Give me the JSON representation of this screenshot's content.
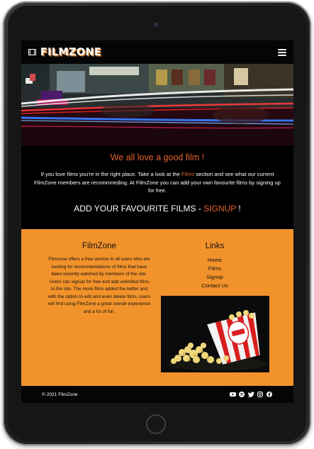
{
  "navbar": {
    "logo_text": "FILMZONE",
    "logo_icon": "film-icon",
    "menu_icon": "hamburger-menu-icon"
  },
  "hero": {
    "image": "night street with car light trails"
  },
  "intro": {
    "heading": "We all love a good film !",
    "text_before": "If you love films you're in the right place. Take a look at the ",
    "films_link": "Films",
    "text_after": " section and see what our current FilmZone members are recommneding. At FilmZone you can add your own favourite films by signing up for free.",
    "cta_before": "ADD YOUR FAVOURITE FILMS - ",
    "cta_signup": "SIGNUP",
    "cta_after": " !"
  },
  "footer": {
    "about_title": "FilmZone",
    "about_text": "Filmzone offers a free service to all users who are looking for recommendations of films that have been recently watched by members of the site. Users can signup for free and add unlimited films to the site. The more films added the better and with the option to edit and even delete films, users will find using FilmZone a great overall experience and a lot of fun.",
    "links_title": "Links",
    "links": [
      "Home",
      "Films",
      "Signup",
      "Contact Us"
    ],
    "image": "popcorn box"
  },
  "bottom": {
    "copyright": "© 2021 FilmZone",
    "social_icons": [
      "youtube-icon",
      "spotify-icon",
      "twitter-icon",
      "instagram-icon",
      "facebook-icon"
    ]
  },
  "colors": {
    "accent": "#e5622d",
    "footer_bg": "#f2922b",
    "logo_shadow": "#d07a2a"
  }
}
